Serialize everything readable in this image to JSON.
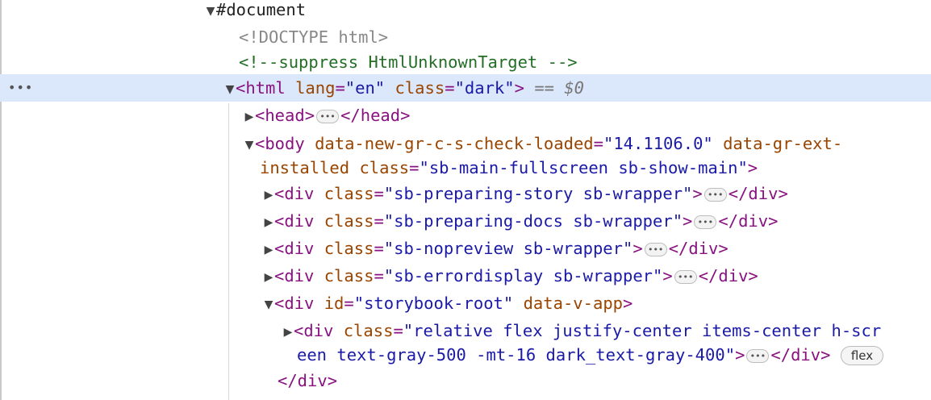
{
  "tree": {
    "document": "#document",
    "doctype": "<!DOCTYPE html>",
    "comment": "<!--suppress HtmlUnknownTarget -->",
    "html_row": {
      "selected_marker": "== $0",
      "row_menu": "•••"
    },
    "head": {
      "open": "<head>",
      "close": "</head>"
    },
    "body": {
      "attr1_name": "data-new-gr-c-s-check-loaded",
      "attr1_value": "\"14.1106.0\"",
      "attr2_line1": "data-gr-ext-",
      "attr2_line2": "installed",
      "class_value": "\"sb-main-fullscreen sb-show-main\""
    },
    "divs": [
      {
        "class_value": "\"sb-preparing-story sb-wrapper\""
      },
      {
        "class_value": "\"sb-preparing-docs sb-wrapper\""
      },
      {
        "class_value": "\"sb-nopreview sb-wrapper\""
      },
      {
        "class_value": "\"sb-errordisplay sb-wrapper\""
      }
    ],
    "root_div": {
      "id_value": "\"storybook-root\"",
      "extra_attr": "data-v-app"
    },
    "inner_div": {
      "class_value_line1": "\"relative flex justify-center items-center h-scr",
      "class_value_line2": "een text-gray-500 -mt-16 dark_text-gray-400\"",
      "badge": "flex"
    },
    "close_div": "</div>",
    "ellipsis": "•••"
  }
}
